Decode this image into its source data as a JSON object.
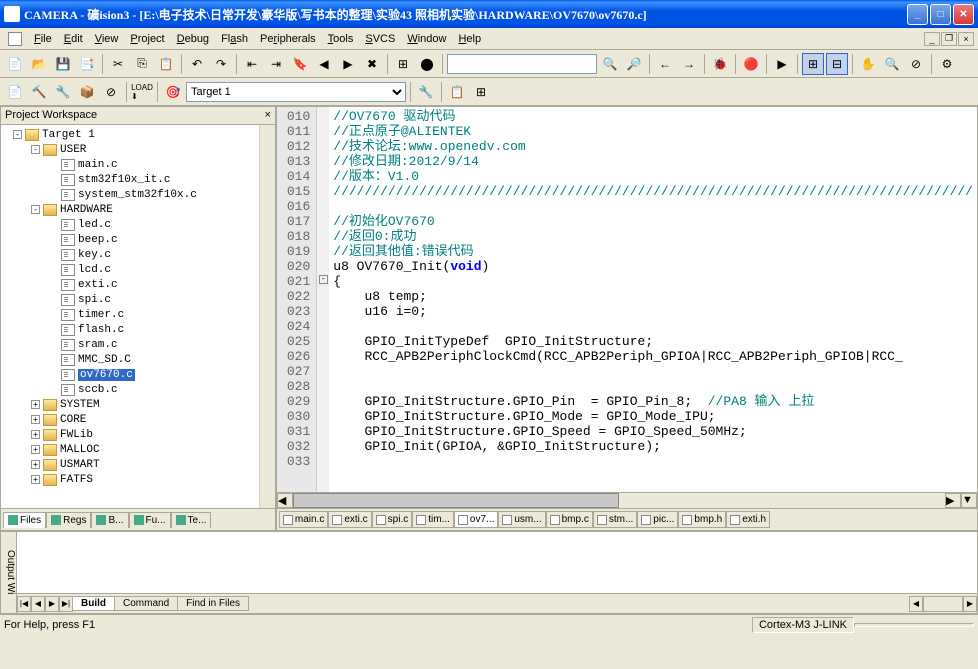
{
  "window": {
    "title": "CAMERA  - 礦ision3 - [E:\\电子技术\\日常开发\\豪华版\\写书本的整理\\实验43 照相机实验\\HARDWARE\\OV7670\\ov7670.c]"
  },
  "menu": {
    "file": "File",
    "edit": "Edit",
    "view": "View",
    "project": "Project",
    "debug": "Debug",
    "flash": "Flash",
    "peripherals": "Peripherals",
    "tools": "Tools",
    "svcs": "SVCS",
    "window": "Window",
    "help": "Help"
  },
  "toolbar": {
    "target_combo": "Target 1",
    "find_combo": ""
  },
  "workspace": {
    "title": "Project Workspace",
    "tree": [
      {
        "level": 0,
        "exp": "-",
        "type": "target",
        "label": "Target 1"
      },
      {
        "level": 1,
        "exp": "-",
        "type": "folder",
        "label": "USER"
      },
      {
        "level": 2,
        "exp": "",
        "type": "file",
        "label": "main.c"
      },
      {
        "level": 2,
        "exp": "",
        "type": "file",
        "label": "stm32f10x_it.c"
      },
      {
        "level": 2,
        "exp": "",
        "type": "file",
        "label": "system_stm32f10x.c"
      },
      {
        "level": 1,
        "exp": "-",
        "type": "folder",
        "label": "HARDWARE"
      },
      {
        "level": 2,
        "exp": "",
        "type": "file",
        "label": "led.c"
      },
      {
        "level": 2,
        "exp": "",
        "type": "file",
        "label": "beep.c"
      },
      {
        "level": 2,
        "exp": "",
        "type": "file",
        "label": "key.c"
      },
      {
        "level": 2,
        "exp": "",
        "type": "file",
        "label": "lcd.c"
      },
      {
        "level": 2,
        "exp": "",
        "type": "file",
        "label": "exti.c"
      },
      {
        "level": 2,
        "exp": "",
        "type": "file",
        "label": "spi.c"
      },
      {
        "level": 2,
        "exp": "",
        "type": "file",
        "label": "timer.c"
      },
      {
        "level": 2,
        "exp": "",
        "type": "file",
        "label": "flash.c"
      },
      {
        "level": 2,
        "exp": "",
        "type": "file",
        "label": "sram.c"
      },
      {
        "level": 2,
        "exp": "",
        "type": "file",
        "label": "MMC_SD.C"
      },
      {
        "level": 2,
        "exp": "",
        "type": "file",
        "label": "ov7670.c",
        "selected": true
      },
      {
        "level": 2,
        "exp": "",
        "type": "file",
        "label": "sccb.c"
      },
      {
        "level": 1,
        "exp": "+",
        "type": "folder",
        "label": "SYSTEM"
      },
      {
        "level": 1,
        "exp": "+",
        "type": "folder",
        "label": "CORE"
      },
      {
        "level": 1,
        "exp": "+",
        "type": "folder",
        "label": "FWLib"
      },
      {
        "level": 1,
        "exp": "+",
        "type": "folder",
        "label": "MALLOC"
      },
      {
        "level": 1,
        "exp": "+",
        "type": "folder",
        "label": "USMART"
      },
      {
        "level": 1,
        "exp": "+",
        "type": "folder",
        "label": "FATFS"
      }
    ],
    "tabs": [
      {
        "label": "Files",
        "active": true
      },
      {
        "label": "Regs"
      },
      {
        "label": "B..."
      },
      {
        "label": "Fu..."
      },
      {
        "label": "Te..."
      }
    ]
  },
  "editor": {
    "lines": [
      {
        "n": "010",
        "html": "<span class='c-comment'>//OV7670 驱动代码</span>"
      },
      {
        "n": "011",
        "html": "<span class='c-comment'>//正点原子@ALIENTEK</span>"
      },
      {
        "n": "012",
        "html": "<span class='c-comment'>//技术论坛:www.openedv.com</span>"
      },
      {
        "n": "013",
        "html": "<span class='c-comment'>//修改日期:2012/9/14</span>"
      },
      {
        "n": "014",
        "html": "<span class='c-comment'>//版本：V1.0</span>"
      },
      {
        "n": "015",
        "html": "<span class='c-comment'>//////////////////////////////////////////////////////////////////////////////////</span>"
      },
      {
        "n": "016",
        "html": ""
      },
      {
        "n": "017",
        "html": "<span class='c-comment'>//初始化OV7670</span>"
      },
      {
        "n": "018",
        "html": "<span class='c-comment'>//返回0:成功</span>"
      },
      {
        "n": "019",
        "html": "<span class='c-comment'>//返回其他值:错误代码</span>"
      },
      {
        "n": "020",
        "html": "u8 OV7670_Init(<span class='c-keyword'>void</span>)"
      },
      {
        "n": "021",
        "html": "{",
        "fold": "-"
      },
      {
        "n": "022",
        "html": "    u8 temp;"
      },
      {
        "n": "023",
        "html": "    u16 i=0;"
      },
      {
        "n": "024",
        "html": ""
      },
      {
        "n": "025",
        "html": "    GPIO_InitTypeDef  GPIO_InitStructure;"
      },
      {
        "n": "026",
        "html": "    RCC_APB2PeriphClockCmd(RCC_APB2Periph_GPIOA|RCC_APB2Periph_GPIOB|RCC_"
      },
      {
        "n": "027",
        "html": ""
      },
      {
        "n": "028",
        "html": ""
      },
      {
        "n": "029",
        "html": "    GPIO_InitStructure.GPIO_Pin  = GPIO_Pin_8;  <span class='c-comment'>//PA8 输入 上拉</span>"
      },
      {
        "n": "030",
        "html": "    GPIO_InitStructure.GPIO_Mode = GPIO_Mode_IPU;"
      },
      {
        "n": "031",
        "html": "    GPIO_InitStructure.GPIO_Speed = GPIO_Speed_50MHz;"
      },
      {
        "n": "032",
        "html": "    GPIO_Init(GPIOA, &GPIO_InitStructure);"
      },
      {
        "n": "033",
        "html": ""
      }
    ],
    "tabs": [
      {
        "label": "main.c"
      },
      {
        "label": "exti.c"
      },
      {
        "label": "spi.c"
      },
      {
        "label": "tim..."
      },
      {
        "label": "ov7...",
        "active": true
      },
      {
        "label": "usm..."
      },
      {
        "label": "bmp.c"
      },
      {
        "label": "stm..."
      },
      {
        "label": "pic..."
      },
      {
        "label": "bmp.h"
      },
      {
        "label": "exti.h"
      }
    ]
  },
  "output": {
    "label": "Output Wi",
    "tabs": [
      {
        "label": "Build",
        "active": true
      },
      {
        "label": "Command"
      },
      {
        "label": "Find in Files"
      }
    ]
  },
  "statusbar": {
    "help": "For Help, press F1",
    "debug": "Cortex-M3 J-LINK"
  }
}
